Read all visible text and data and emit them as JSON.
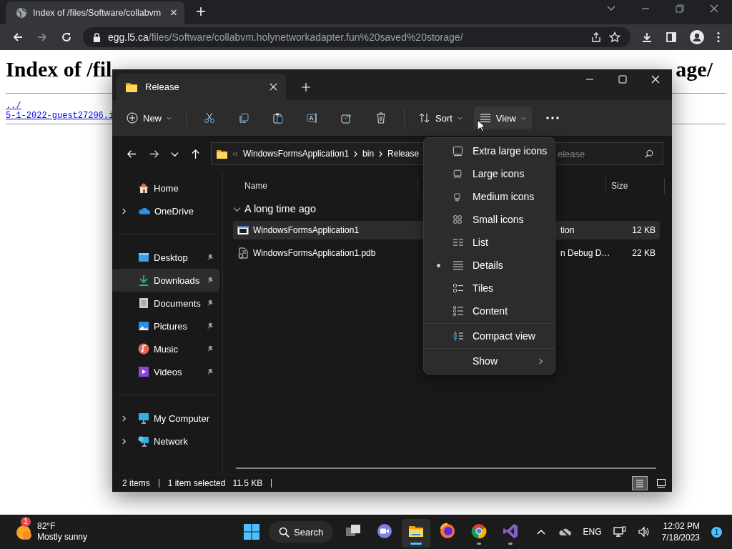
{
  "browser": {
    "tab_title": "Index of /files/Software/collabvm",
    "tab_close": "×",
    "new_tab": "+",
    "address_domain": "egg.l5.ca",
    "address_path": "/files/Software/collabvm.holynetworkadapter.fun%20saved%20storage/"
  },
  "page": {
    "heading_start": "Index of /fil",
    "heading_end": "age/",
    "links": [
      "../",
      "5-1-2022-guest27206.i"
    ]
  },
  "explorer": {
    "tab_title": "Release",
    "new": "New",
    "sort": "Sort",
    "view": "View",
    "breadcrumb": [
      "WindowsFormsApplication1",
      "bin",
      "Release"
    ],
    "search_placeholder": "elease",
    "sidebar": [
      [
        {
          "label": "Home",
          "pinned": false,
          "selected": false
        },
        {
          "label": "OneDrive",
          "pinned": false,
          "selected": false,
          "expanded": false
        }
      ],
      [
        {
          "label": "Desktop",
          "pinned": true,
          "selected": false
        },
        {
          "label": "Downloads",
          "pinned": true,
          "selected": true
        },
        {
          "label": "Documents",
          "pinned": true,
          "selected": false
        },
        {
          "label": "Pictures",
          "pinned": true,
          "selected": false
        },
        {
          "label": "Music",
          "pinned": true,
          "selected": false
        },
        {
          "label": "Videos",
          "pinned": true,
          "selected": false
        }
      ],
      [
        {
          "label": "My Computer",
          "pinned": false,
          "selected": false,
          "expanded": false
        },
        {
          "label": "Network",
          "pinned": false,
          "selected": false,
          "expanded": false
        }
      ]
    ],
    "columns": {
      "name": "Name",
      "size": "Size"
    },
    "group": {
      "label": "A long time ago",
      "expanded": true
    },
    "files": [
      {
        "name": "WindowsFormsApplication1",
        "type": "tion",
        "size": "12 KB",
        "selected": true
      },
      {
        "name": "WindowsFormsApplication1.pdb",
        "type": "n Debug D…",
        "size": "22 KB",
        "selected": false
      }
    ],
    "status": [
      "2 items",
      "1 item selected",
      "11.5 KB"
    ],
    "view_buttons": [
      {
        "selected": true
      },
      {
        "selected": false
      }
    ],
    "menu": [
      [
        {
          "label": "Extra large icons",
          "selected": false
        },
        {
          "label": "Large icons",
          "selected": false
        },
        {
          "label": "Medium icons",
          "selected": false
        },
        {
          "label": "Small icons",
          "selected": false
        },
        {
          "label": "List",
          "selected": false
        },
        {
          "label": "Details",
          "selected": true
        },
        {
          "label": "Tiles",
          "selected": false
        },
        {
          "label": "Content",
          "selected": false
        }
      ],
      [
        {
          "label": "Compact view",
          "selected": false
        }
      ],
      [
        {
          "label": "Show",
          "selected": false,
          "submenu": true
        }
      ]
    ]
  },
  "taskbar": {
    "weather_badge": "1",
    "temperature": "82°F",
    "weather": "Mostly sunny",
    "search": "Search",
    "apps": [
      {
        "open": false,
        "active": false
      },
      {
        "open": false,
        "active": false
      },
      {
        "open": true,
        "active": true
      },
      {
        "open": false,
        "active": false
      },
      {
        "open": true,
        "active": false
      },
      {
        "open": true,
        "active": false
      }
    ],
    "language": "ENG",
    "time": "12:02 PM",
    "date": "7/18/2023",
    "notifications": "1"
  }
}
